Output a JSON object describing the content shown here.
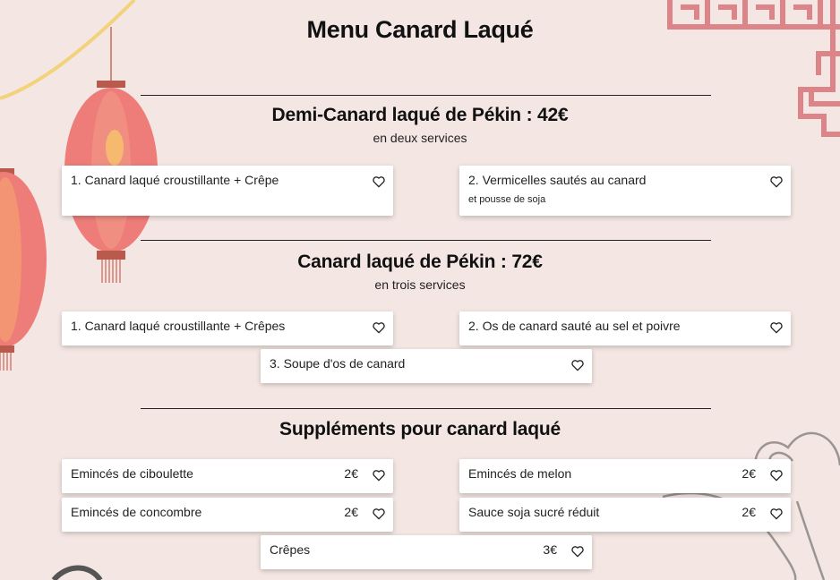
{
  "page_title": "Menu Canard Laqué",
  "sections": [
    {
      "title": "Demi-Canard laqué de Pékin : 42€",
      "subtitle": "en deux services",
      "items": [
        {
          "name": "1. Canard laqué croustillante + Crêpe",
          "desc": "",
          "price": ""
        },
        {
          "name": "2. Vermicelles sautés au canard",
          "desc": "et pousse de soja",
          "price": ""
        }
      ]
    },
    {
      "title": "Canard laqué de Pékin : 72€",
      "subtitle": "en trois services",
      "items": [
        {
          "name": "1. Canard laqué croustillante + Crêpes",
          "desc": "",
          "price": ""
        },
        {
          "name": "2. Os de canard sauté au sel et poivre",
          "desc": "",
          "price": ""
        },
        {
          "name": "3. Soupe d'os de canard",
          "desc": "",
          "price": ""
        }
      ]
    },
    {
      "title": "Suppléments pour canard laqué",
      "subtitle": "",
      "items": [
        {
          "name": "Emincés de ciboulette",
          "desc": "",
          "price": "2€"
        },
        {
          "name": "Emincés de melon",
          "desc": "",
          "price": "2€"
        },
        {
          "name": "Emincés de concombre",
          "desc": "",
          "price": "2€"
        },
        {
          "name": "Sauce soja sucré réduit",
          "desc": "",
          "price": "2€"
        },
        {
          "name": "Crêpes",
          "desc": "",
          "price": "3€"
        }
      ]
    }
  ],
  "icons": {
    "favorite": "heart-outline-icon"
  },
  "colors": {
    "background": "#f4e7e3",
    "lantern": "#ee7d7a",
    "lattice": "#d9737a",
    "card": "#ffffff"
  }
}
